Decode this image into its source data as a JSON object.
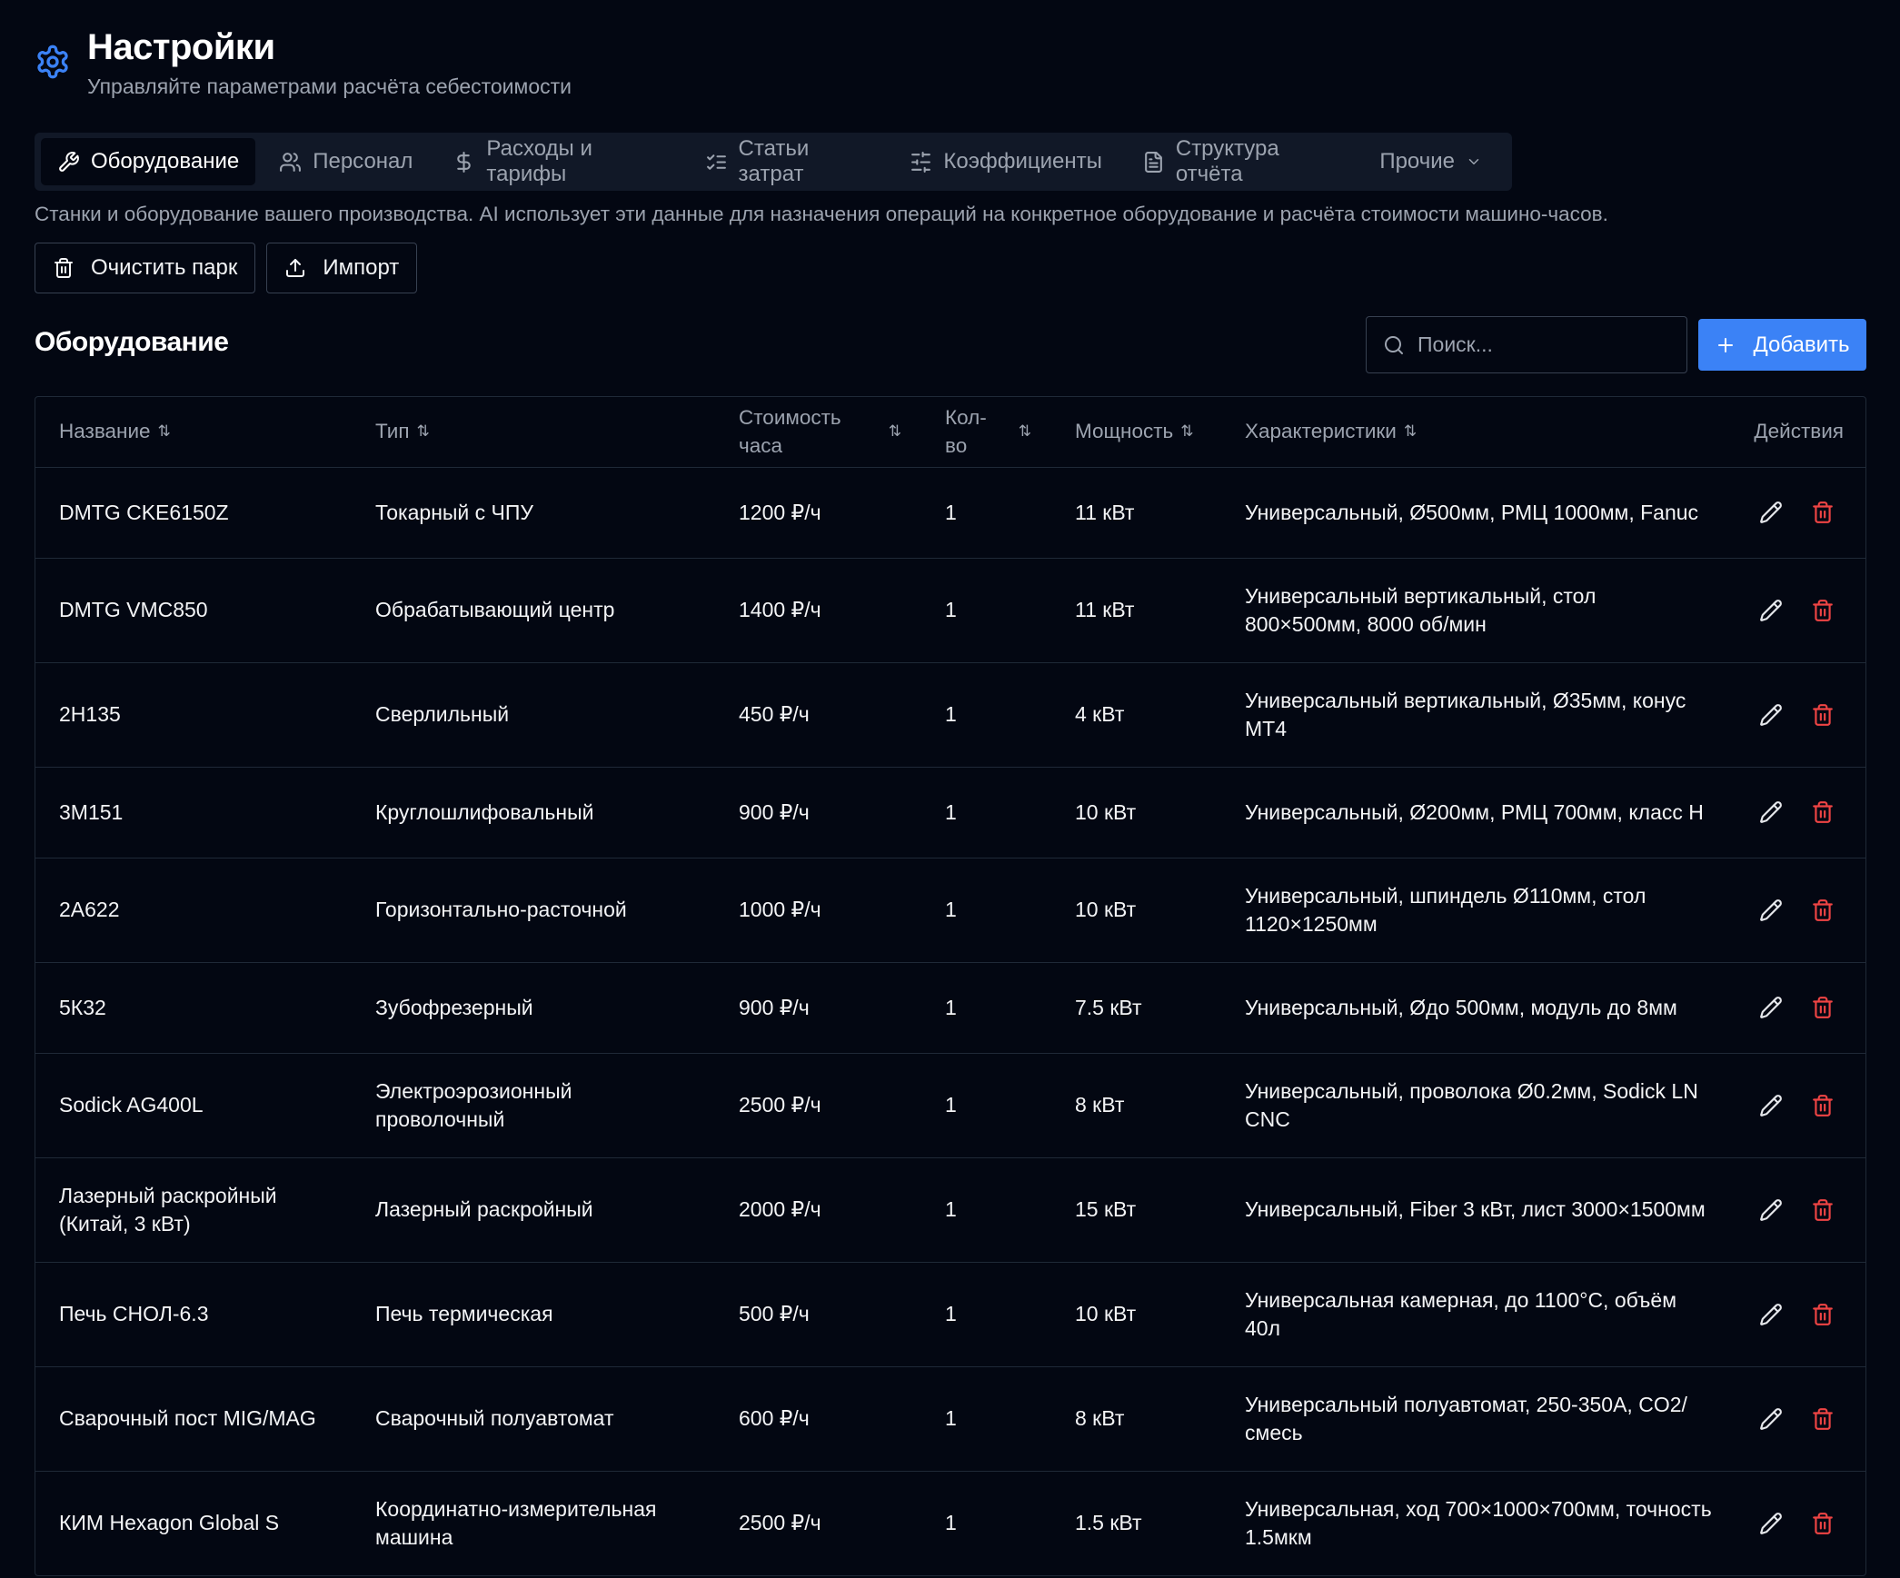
{
  "header": {
    "title": "Настройки",
    "subtitle": "Управляйте параметрами расчёта себестоимости"
  },
  "tabs": [
    {
      "label": "Оборудование",
      "icon": "wrench-icon",
      "active": true
    },
    {
      "label": "Персонал",
      "icon": "users-icon",
      "active": false
    },
    {
      "label": "Расходы и тарифы",
      "icon": "dollar-icon",
      "active": false
    },
    {
      "label": "Статьи затрат",
      "icon": "list-checks-icon",
      "active": false
    },
    {
      "label": "Коэффициенты",
      "icon": "sliders-icon",
      "active": false
    },
    {
      "label": "Структура отчёта",
      "icon": "file-text-icon",
      "active": false
    },
    {
      "label": "Прочие",
      "icon": "chevron-down-icon",
      "active": false
    }
  ],
  "description": "Станки и оборудование вашего производства. AI использует эти данные для назначения операций на конкретное оборудование и расчёта стоимости машино-часов.",
  "toolbar": {
    "clear_label": "Очистить парк",
    "import_label": "Импорт"
  },
  "section": {
    "title": "Оборудование",
    "search_placeholder": "Поиск...",
    "add_label": "Добавить"
  },
  "table": {
    "columns": {
      "name": "Название",
      "type": "Тип",
      "cost_line1": "Стоимость",
      "cost_line2": "часа",
      "qty_line1": "Кол-",
      "qty_line2": "во",
      "power": "Мощность",
      "specs": "Характеристики",
      "actions": "Действия"
    },
    "rows": [
      {
        "name": "DMTG CKE6150Z",
        "type": "Токарный с ЧПУ",
        "cost": "1200 ₽/ч",
        "qty": "1",
        "power": "11 кВт",
        "specs": "Универсальный, Ø500мм, РМЦ 1000мм, Fanuc",
        "tall": false
      },
      {
        "name": "DMTG VMC850",
        "type": "Обрабатывающий центр",
        "cost": "1400 ₽/ч",
        "qty": "1",
        "power": "11 кВт",
        "specs": "Универсальный вертикальный, стол 800×500мм, 8000 об/мин",
        "tall": true
      },
      {
        "name": "2Н135",
        "type": "Сверлильный",
        "cost": "450 ₽/ч",
        "qty": "1",
        "power": "4 кВт",
        "specs": "Универсальный вертикальный, Ø35мм, конус МТ4",
        "tall": true
      },
      {
        "name": "3М151",
        "type": "Круглошлифовальный",
        "cost": "900 ₽/ч",
        "qty": "1",
        "power": "10 кВт",
        "specs": "Универсальный, Ø200мм, РМЦ 700мм, класс Н",
        "tall": false
      },
      {
        "name": "2А622",
        "type": "Горизонтально-расточной",
        "cost": "1000 ₽/ч",
        "qty": "1",
        "power": "10 кВт",
        "specs": "Универсальный, шпиндель Ø110мм, стол 1120×1250мм",
        "tall": true
      },
      {
        "name": "5К32",
        "type": "Зубофрезерный",
        "cost": "900 ₽/ч",
        "qty": "1",
        "power": "7.5 кВт",
        "specs": "Универсальный, Øдо 500мм, модуль до 8мм",
        "tall": false
      },
      {
        "name": "Sodick AG400L",
        "type": "Электроэрозионный проволочный",
        "cost": "2500 ₽/ч",
        "qty": "1",
        "power": "8 кВт",
        "specs": "Универсальный, проволока Ø0.2мм, Sodick LN CNC",
        "tall": true
      },
      {
        "name": "Лазерный раскройный (Китай, 3 кВт)",
        "type": "Лазерный раскройный",
        "cost": "2000 ₽/ч",
        "qty": "1",
        "power": "15 кВт",
        "specs": "Универсальный, Fiber 3 кВт, лист 3000×1500мм",
        "tall": true
      },
      {
        "name": "Печь СНОЛ-6.3",
        "type": "Печь термическая",
        "cost": "500 ₽/ч",
        "qty": "1",
        "power": "10 кВт",
        "specs": "Универсальная камерная, до 1100°C, объём 40л",
        "tall": true
      },
      {
        "name": "Сварочный пост MIG/MAG",
        "type": "Сварочный полуавтомат",
        "cost": "600 ₽/ч",
        "qty": "1",
        "power": "8 кВт",
        "specs": "Универсальный полуавтомат, 250-350А, CO2/смесь",
        "tall": true
      },
      {
        "name": "КИМ Hexagon Global S",
        "type": "Координатно-измерительная машина",
        "cost": "2500 ₽/ч",
        "qty": "1",
        "power": "1.5 кВт",
        "specs": "Универсальная, ход 700×1000×700мм, точность 1.5мкм",
        "tall": true
      }
    ]
  },
  "colors": {
    "background": "#030712",
    "accent": "#3b82f6",
    "danger": "#ef4444",
    "muted_text": "#9ca3af",
    "border": "#1f2937"
  }
}
